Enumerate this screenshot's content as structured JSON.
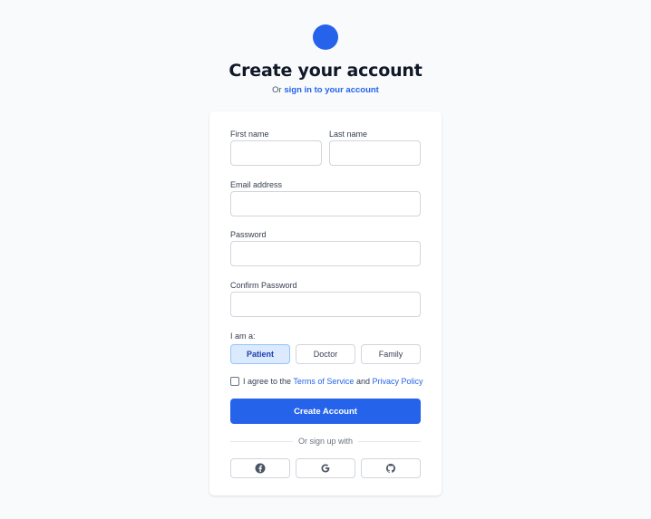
{
  "header": {
    "title": "Create your account",
    "subtitle_prefix": "Or",
    "signin_link": "sign in to your account"
  },
  "form": {
    "first_name_label": "First name",
    "last_name_label": "Last name",
    "email_label": "Email address",
    "password_label": "Password",
    "confirm_password_label": "Confirm Password",
    "role_label": "I am a:",
    "roles": [
      "Patient",
      "Doctor",
      "Family"
    ],
    "selected_role": "Patient",
    "agree_prefix": "I agree to the",
    "terms_link": "Terms of Service",
    "agree_and": "and",
    "privacy_link": "Privacy Policy",
    "submit_label": "Create Account",
    "divider_text": "Or sign up with"
  },
  "social": [
    {
      "icon": "facebook-icon"
    },
    {
      "icon": "google-icon"
    },
    {
      "icon": "github-icon"
    }
  ],
  "colors": {
    "accent": "#2563eb",
    "background": "#f8fafc",
    "selected_role_bg": "#dbeafe"
  }
}
